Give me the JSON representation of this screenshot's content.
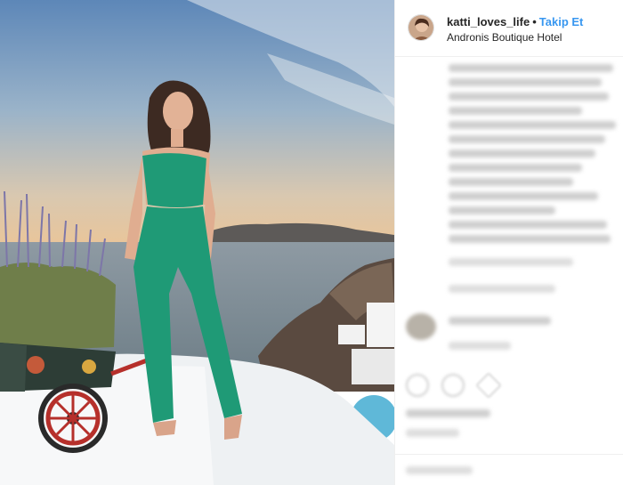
{
  "post": {
    "username": "katti_loves_life",
    "separator": "•",
    "follow_label": "Takip Et",
    "location": "Andronis Boutique Hotel"
  },
  "icons": {
    "avatar": "user-avatar",
    "like": "heart-icon",
    "comment": "comment-icon",
    "share": "share-icon"
  }
}
